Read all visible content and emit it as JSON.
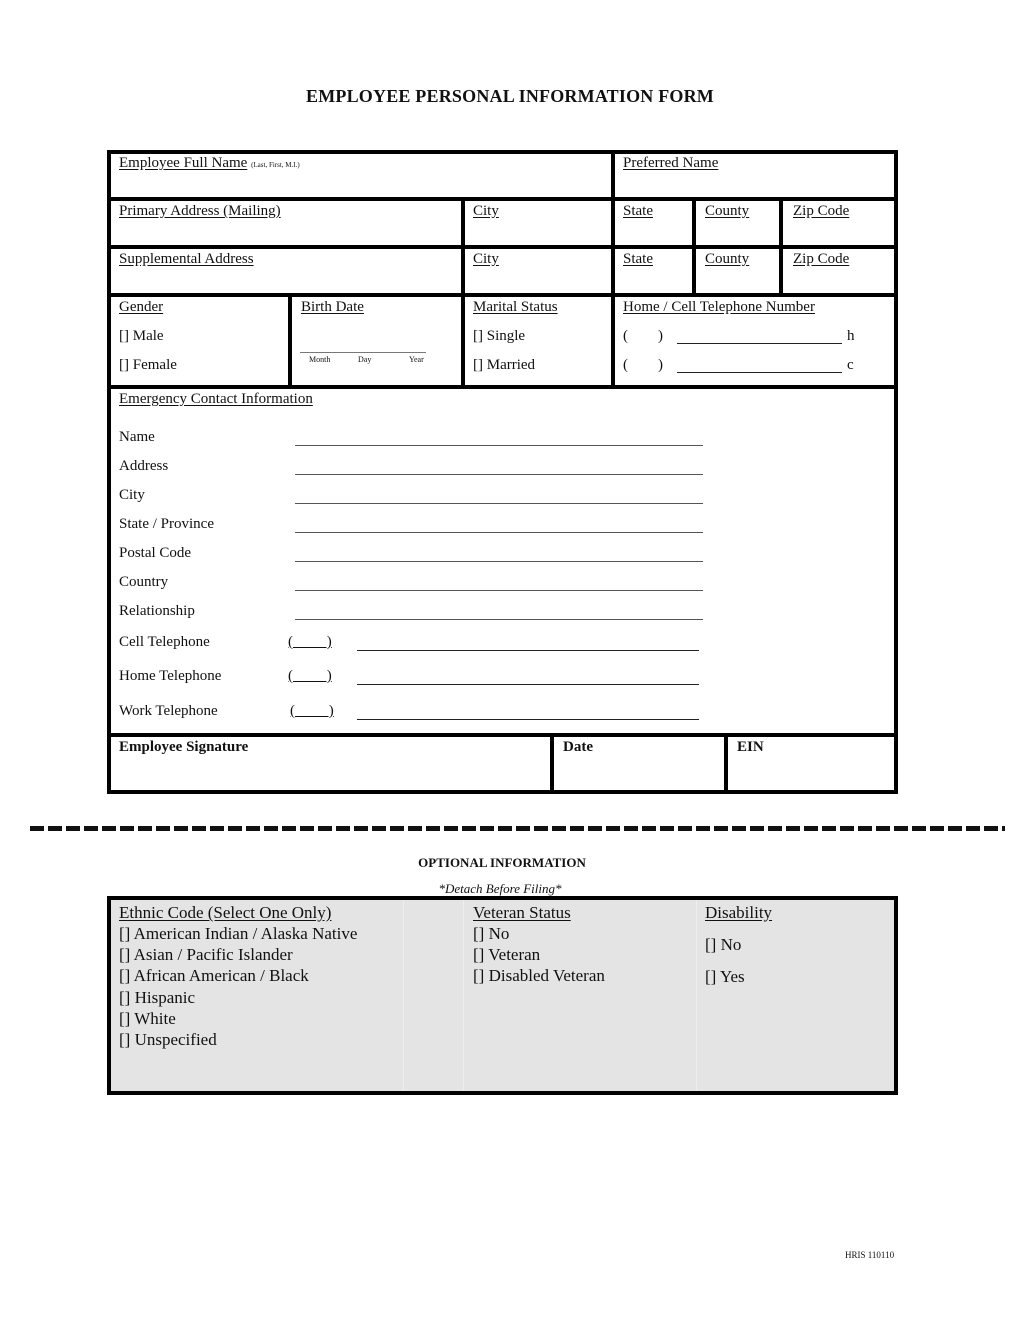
{
  "title": "EMPLOYEE PERSONAL INFORMATION FORM",
  "row1": {
    "full_name_label": "Employee Full Name",
    "full_name_hint": "(Last, First, M.I.)",
    "preferred_name_label": "Preferred Name"
  },
  "row2": {
    "address_label": "Primary Address (Mailing)",
    "city_label": "City",
    "state_label": "State",
    "county_label": "County",
    "zip_label": "Zip Code"
  },
  "row3": {
    "address_label": "Supplemental Address",
    "city_label": "City",
    "state_label": "State",
    "county_label": "County",
    "zip_label": "Zip Code"
  },
  "row4": {
    "gender_label": "Gender",
    "gender_options": [
      "[] Male",
      "[] Female"
    ],
    "birth_date_label": "Birth Date",
    "birth_date_parts": [
      "Month",
      "Day",
      "Year"
    ],
    "marital_label": "Marital Status",
    "marital_options": [
      "[] Single",
      "[] Married"
    ],
    "phone_label": "Home / Cell Telephone Number",
    "phone_lines": [
      {
        "prefix": "(        )",
        "suffix": "h"
      },
      {
        "prefix": "(        )",
        "suffix": "c"
      }
    ]
  },
  "emergency": {
    "heading": "Emergency Contact Information",
    "fields": [
      "Name",
      "Address",
      "City",
      "State / Province",
      "Postal Code",
      "Country",
      "Relationship"
    ],
    "phones": [
      "Cell Telephone",
      "Home Telephone",
      "Work Telephone"
    ],
    "area_code_mark": "(         )"
  },
  "signature_row": {
    "signature_label": "Employee Signature",
    "date_label": "Date",
    "ein_label": "EIN"
  },
  "optional": {
    "heading": "OPTIONAL INFORMATION",
    "subheading": "*Detach Before Filing*",
    "ethnic_label": "Ethnic Code (Select One Only)",
    "ethnic_options": [
      "[] American Indian / Alaska Native",
      "[] Asian / Pacific Islander",
      "[] African American / Black",
      "[] Hispanic",
      "[] White",
      "[] Unspecified"
    ],
    "veteran_label": "Veteran Status",
    "veteran_options": [
      "[] No",
      "[] Veteran",
      "[] Disabled Veteran"
    ],
    "disability_label": "Disability",
    "disability_options": [
      "[] No",
      "[] Yes"
    ]
  },
  "footer_code": "HRIS 110110",
  "colors": {
    "border": "#000000",
    "shaded_bg": "#e4e4e4"
  }
}
